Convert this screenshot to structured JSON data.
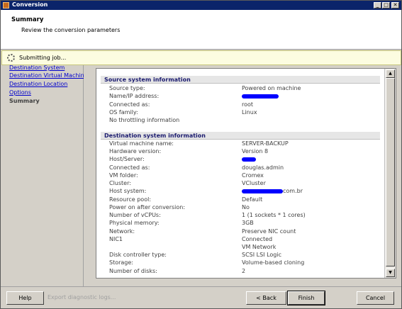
{
  "window": {
    "title": "Conversion",
    "controls": {
      "minimize": "_",
      "maximize": "□",
      "close": "✕"
    }
  },
  "header": {
    "title": "Summary",
    "subtitle": "Review the conversion parameters"
  },
  "status": {
    "text": "Submitting job..."
  },
  "nav": {
    "items": [
      {
        "label": "Destination System",
        "current": false
      },
      {
        "label": "Destination Virtual Machine",
        "current": false
      },
      {
        "label": "Destination Location",
        "current": false
      },
      {
        "label": "Options",
        "current": false
      },
      {
        "label": "Summary",
        "current": true
      }
    ]
  },
  "source": {
    "heading": "Source system information",
    "rows": [
      {
        "label": "Source type:",
        "value": "Powered on machine"
      },
      {
        "label": "Name/IP address:",
        "value": ""
      },
      {
        "label": "Connected as:",
        "value": "root"
      },
      {
        "label": "OS family:",
        "value": "Linux"
      },
      {
        "label": "No throttling information",
        "value": ""
      }
    ]
  },
  "destination": {
    "heading": "Destination system information",
    "rows": [
      {
        "label": "Virtual machine name:",
        "value": "SERVER-BACKUP"
      },
      {
        "label": "Hardware version:",
        "value": "Version 8"
      },
      {
        "label": "Host/Server:",
        "value": ""
      },
      {
        "label": "Connected as:",
        "value": "douglas.admin"
      },
      {
        "label": "VM folder:",
        "value": "Cromex"
      },
      {
        "label": "Cluster:",
        "value": "VCluster"
      },
      {
        "label": "Host system:",
        "value": "com.br"
      },
      {
        "label": "Resource pool:",
        "value": "Default"
      },
      {
        "label": "Power on after conversion:",
        "value": "No"
      },
      {
        "label": "Number of vCPUs:",
        "value": "1 (1 sockets * 1 cores)"
      },
      {
        "label": "Physical memory:",
        "value": "3GB"
      },
      {
        "label": "Network:",
        "value": "Preserve NIC count"
      },
      {
        "label": "NIC1",
        "value": "Connected"
      },
      {
        "label": "",
        "value": "VM Network"
      },
      {
        "label": "Disk controller type:",
        "value": "SCSI LSI Logic"
      },
      {
        "label": "Storage:",
        "value": "Volume-based cloning"
      },
      {
        "label": "Number of disks:",
        "value": "2"
      }
    ]
  },
  "footer": {
    "help": "Help",
    "export": "Export diagnostic logs...",
    "back": "< Back",
    "finish": "Finish",
    "cancel": "Cancel"
  },
  "colors": {
    "titlebar": "#0b246a",
    "link": "#0000cc",
    "redaction": "#0000ff"
  }
}
